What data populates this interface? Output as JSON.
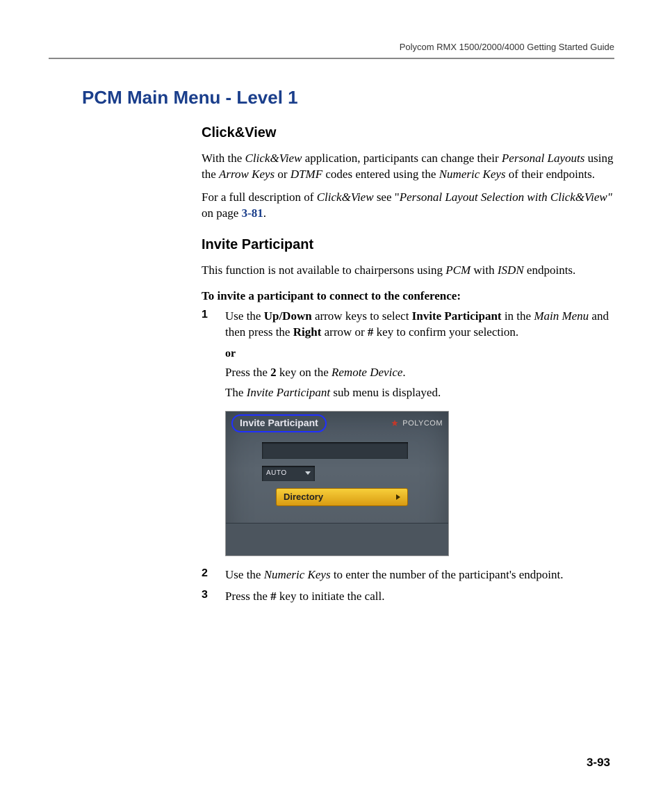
{
  "header": {
    "doc_title": "Polycom RMX 1500/2000/4000 Getting Started Guide"
  },
  "section": {
    "title": "PCM Main Menu - Level 1"
  },
  "clickview": {
    "heading": "Click&View",
    "p1_a": "With the ",
    "p1_b": "Click&View",
    "p1_c": " application, participants can change their ",
    "p1_d": "Personal Layouts",
    "p1_e": " using the ",
    "p1_f": "Arrow Keys",
    "p1_g": " or ",
    "p1_h": "DTMF",
    "p1_i": " codes entered using the ",
    "p1_j": "Numeric Keys",
    "p1_k": " of their endpoints.",
    "p2_a": "For a full description of ",
    "p2_b": "Click&View",
    "p2_c": " see \"",
    "p2_d": "Personal Layout Selection with Click&View\"",
    "p2_e": " on page ",
    "p2_ref": "3-81",
    "p2_f": "."
  },
  "invite": {
    "heading": "Invite Participant",
    "p1_a": "This function is not available to chairpersons using ",
    "p1_b": "PCM",
    "p1_c": " with ",
    "p1_d": "ISDN",
    "p1_e": " endpoints.",
    "instr_lead": "To invite a participant to connect to the conference:",
    "steps": {
      "s1_num": "1",
      "s1_a": "Use the ",
      "s1_b": "Up/Down",
      "s1_c": " arrow keys to select ",
      "s1_d": "Invite Participant",
      "s1_e": " in the ",
      "s1_f": "Main Menu",
      "s1_g": " and then press the ",
      "s1_h": "Right",
      "s1_i": " arrow or ",
      "s1_j": "#",
      "s1_k": " key to confirm your selection.",
      "or": "or",
      "alt1_a": "Press the ",
      "alt1_b": "2",
      "alt1_c": " key on the ",
      "alt1_d": "Remote Device",
      "alt1_e": ".",
      "alt2_a": "The ",
      "alt2_b": "Invite Participant",
      "alt2_c": " sub menu is displayed.",
      "s2_num": "2",
      "s2_a": "Use the ",
      "s2_b": "Numeric Keys",
      "s2_c": " to enter the number of the participant's endpoint.",
      "s3_num": "3",
      "s3_a": "Press the ",
      "s3_b": "#",
      "s3_c": " key to initiate the call."
    }
  },
  "figure": {
    "tab_label": "Invite Participant",
    "brand": "POLYCOM",
    "auto_label": "AUTO",
    "directory_label": "Directory"
  },
  "page_number": "3-93"
}
